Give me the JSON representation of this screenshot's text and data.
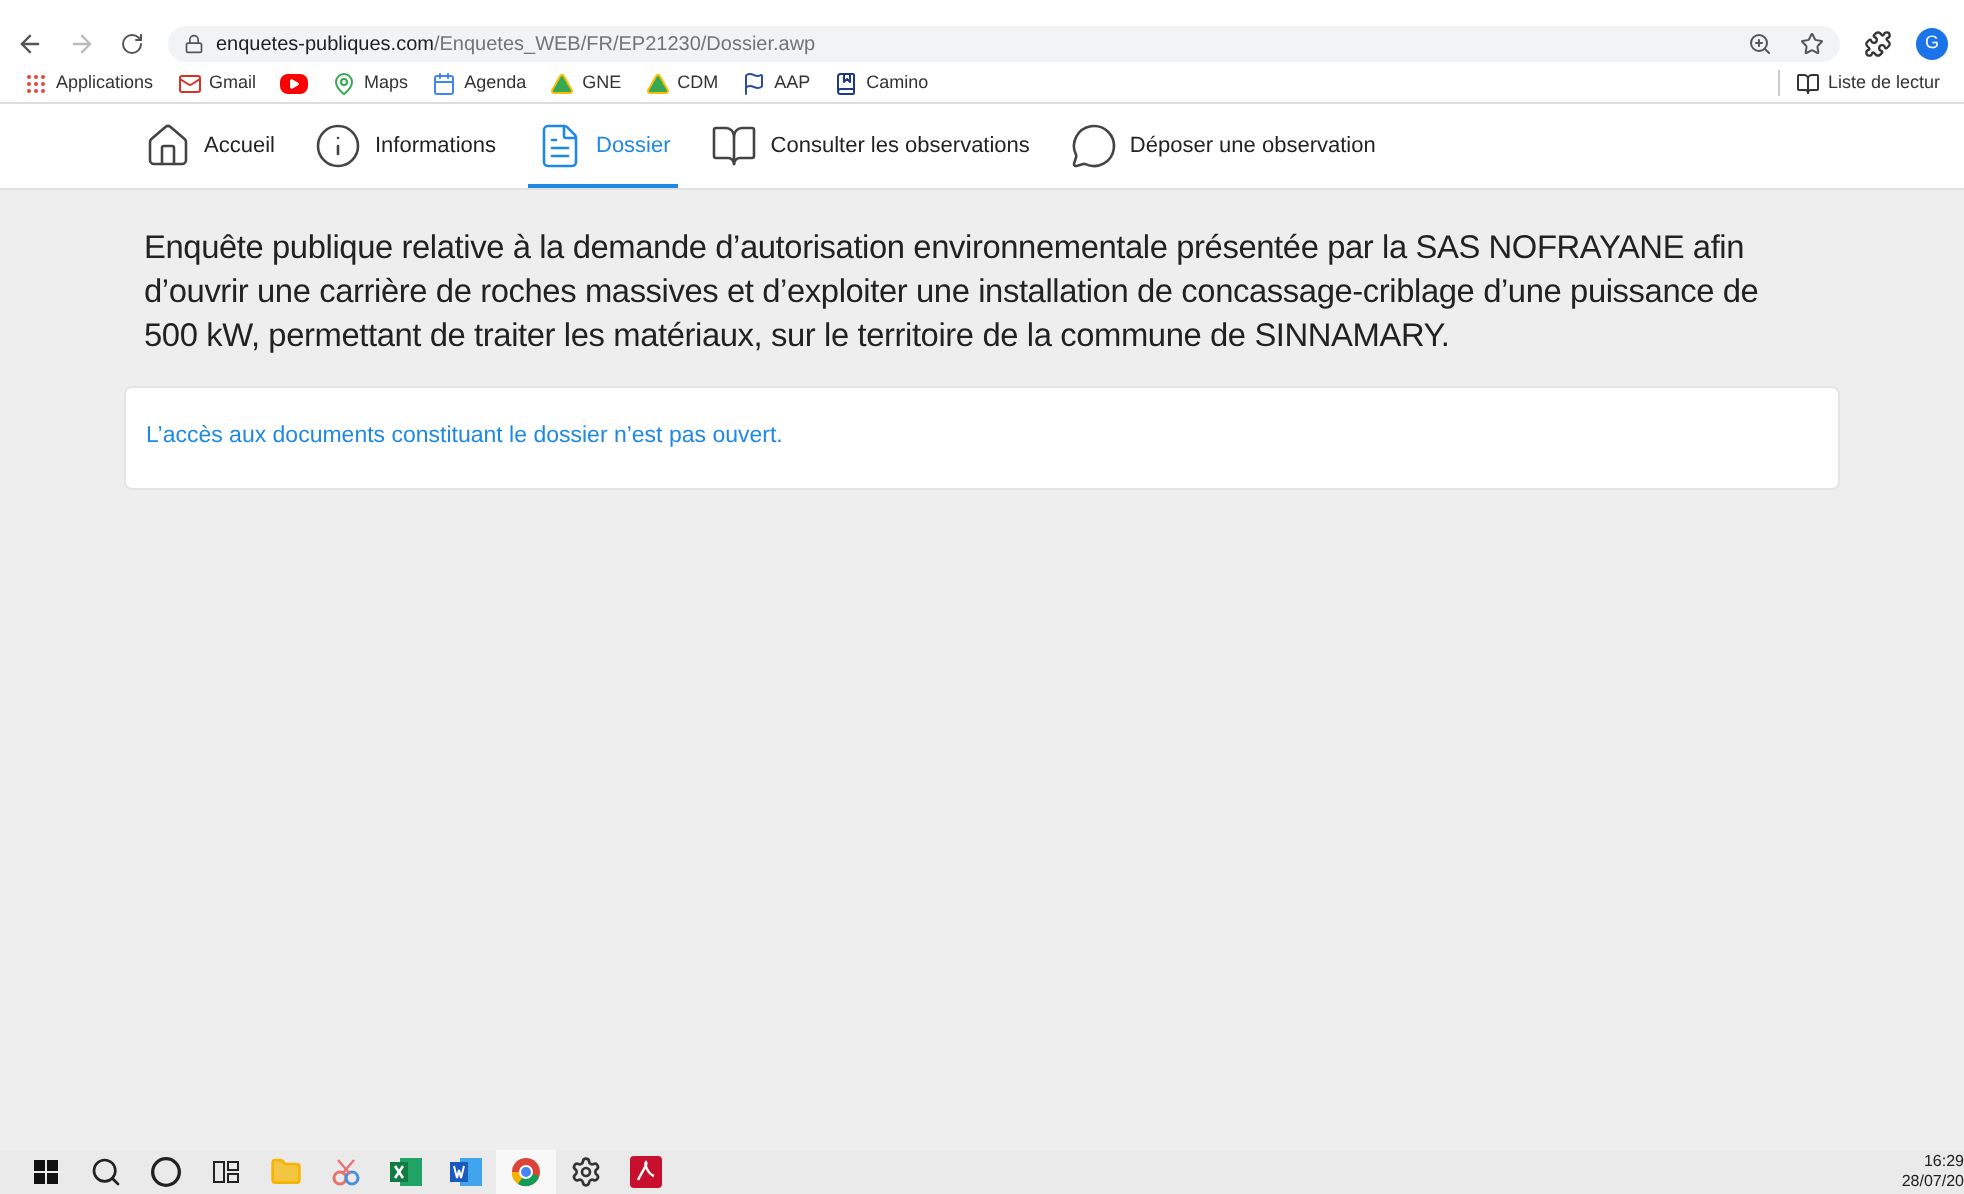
{
  "browser": {
    "url_host": "enquetes-publiques.com",
    "url_path": "/Enquetes_WEB/FR/EP21230/Dossier.awp",
    "profile_initial": "G"
  },
  "bookmarks": [
    {
      "label": "Applications",
      "kind": "apps"
    },
    {
      "label": "Gmail",
      "kind": "gmail"
    },
    {
      "kind": "youtube"
    },
    {
      "label": "Maps",
      "kind": "maps"
    },
    {
      "label": "Agenda",
      "kind": "calendar"
    },
    {
      "label": "GNE",
      "kind": "drive"
    },
    {
      "label": "CDM",
      "kind": "drive"
    },
    {
      "label": "AAP",
      "kind": "flag"
    },
    {
      "label": "Camino",
      "kind": "camino"
    }
  ],
  "reading_list": "Liste de lectur",
  "nav_tabs": [
    {
      "label": "Accueil",
      "kind": "home",
      "selected": false
    },
    {
      "label": "Informations",
      "kind": "info",
      "selected": false
    },
    {
      "label": "Dossier",
      "kind": "file",
      "selected": true
    },
    {
      "label": "Consulter les observations",
      "kind": "book",
      "selected": false
    },
    {
      "label": "Déposer une observation",
      "kind": "comment",
      "selected": false
    }
  ],
  "heading": "Enquête publique relative à la demande d’autorisation environnementale présentée par la SAS NOFRAYANE afin d’ouvrir une carrière de roches massives et d’exploiter une installation de concassage-criblage d’une puissance de 500 kW, permettant de traiter les matériaux, sur le territoire de la commune de SINNAMARY.",
  "notice": "L’accès aux documents constituant le dossier n’est pas ouvert.",
  "taskbar": {
    "apps": [
      {
        "kind": "start",
        "selected": false
      },
      {
        "kind": "search",
        "selected": false
      },
      {
        "kind": "cortana",
        "selected": false
      },
      {
        "kind": "taskview",
        "selected": false
      },
      {
        "kind": "explorer",
        "selected": false
      },
      {
        "kind": "snip",
        "selected": false
      },
      {
        "kind": "excel",
        "selected": false
      },
      {
        "kind": "word",
        "selected": false
      },
      {
        "kind": "chrome",
        "selected": true
      },
      {
        "kind": "settings",
        "selected": false
      },
      {
        "kind": "pdf",
        "selected": false
      }
    ],
    "time": "16:29",
    "date": "28/07/20"
  }
}
